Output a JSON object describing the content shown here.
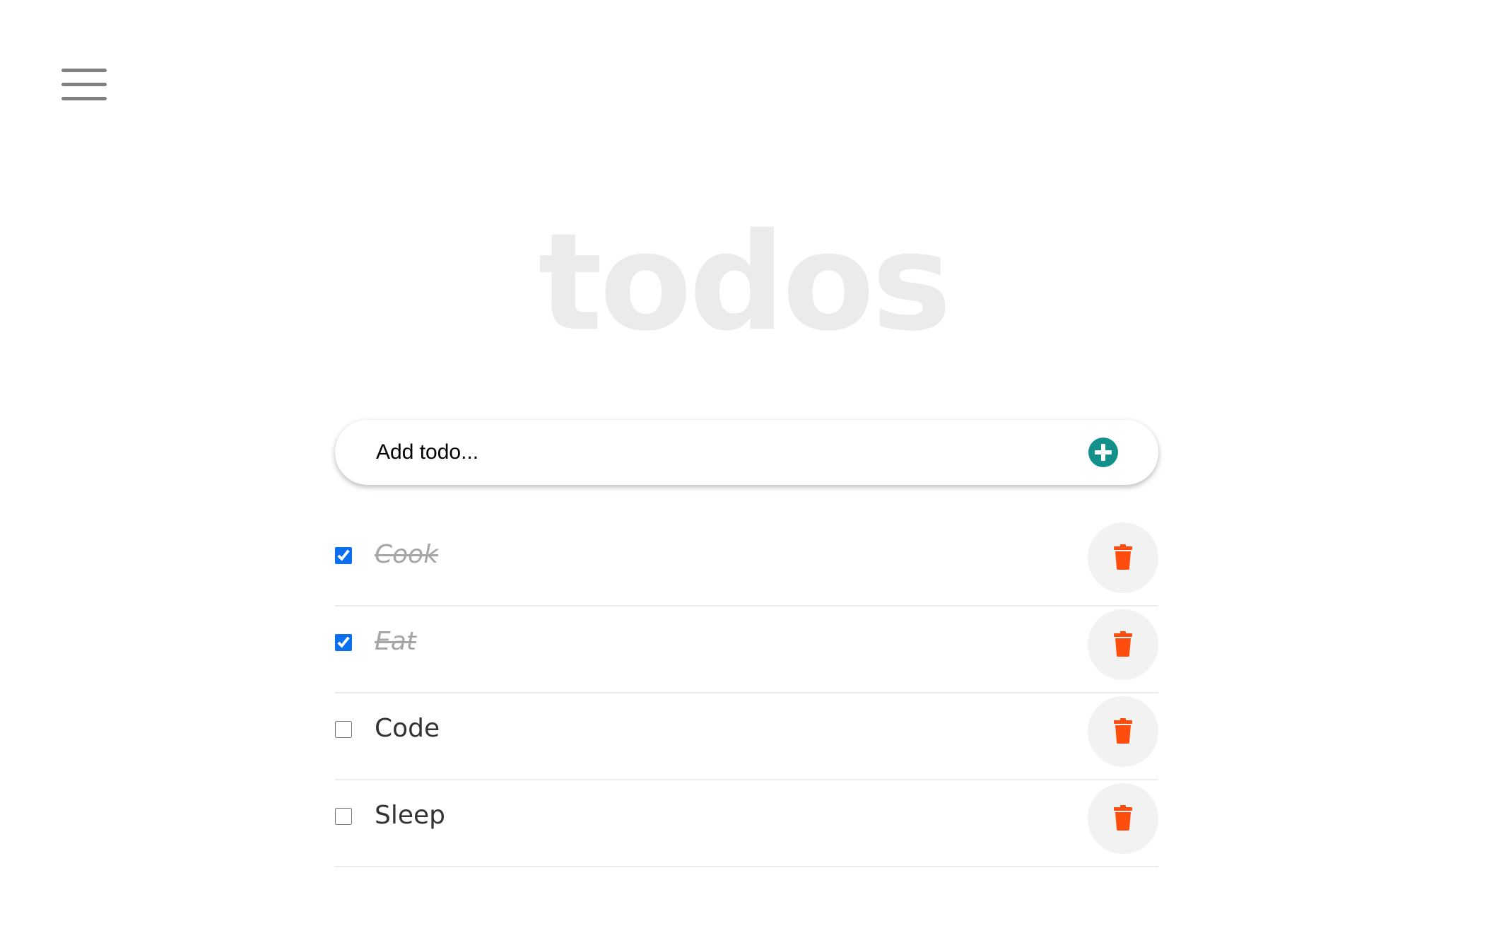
{
  "header": {
    "menu_icon": "hamburger-menu-icon",
    "title": "todos"
  },
  "add_form": {
    "placeholder": "Add todo...",
    "add_icon": "plus-circle-icon"
  },
  "colors": {
    "accent_add": "#14908a",
    "accent_delete": "#ff4d0d",
    "checkbox": "#0b6ff0"
  },
  "todos": [
    {
      "label": "Cook",
      "completed": true,
      "delete_icon": "trash-icon"
    },
    {
      "label": "Eat",
      "completed": true,
      "delete_icon": "trash-icon"
    },
    {
      "label": "Code",
      "completed": false,
      "delete_icon": "trash-icon"
    },
    {
      "label": "Sleep",
      "completed": false,
      "delete_icon": "trash-icon"
    }
  ]
}
